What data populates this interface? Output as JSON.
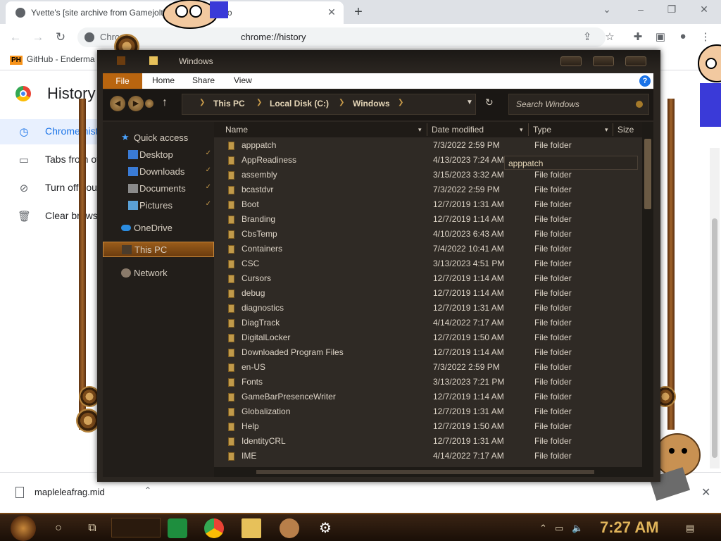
{
  "browser": {
    "tab_title": "Yvette's [site archive from Gamejolt] by Yvette - itch.io",
    "tab_close": "✕",
    "new_tab": "+",
    "window_controls": [
      "⌄",
      "–",
      "❐",
      "✕"
    ],
    "back": "←",
    "forward": "→",
    "reload": "↻",
    "url_chip": "Chrome",
    "url_path": "chrome://history",
    "toolbar_icons": [
      "share-icon",
      "star-icon",
      "extensions-icon",
      "sidepanel-icon",
      "profile-icon",
      "menu-icon"
    ],
    "bookmark": {
      "badge": "PH",
      "label": "GitHub - Enderma"
    },
    "history": {
      "title": "History",
      "nav": [
        {
          "label": "Chrome history",
          "icon": "clock-icon",
          "active": true
        },
        {
          "label": "Tabs from other devices",
          "icon": "devices-icon",
          "active": false
        },
        {
          "label": "Turn off Journeys",
          "icon": "journeys-off-icon",
          "active": false
        },
        {
          "label": "Clear browsing data",
          "icon": "trash-icon",
          "active": false
        }
      ]
    },
    "download": {
      "filename": "mapleleafrag.mid",
      "caret": "⌃",
      "close": "✕"
    }
  },
  "explorer": {
    "title": "Windows",
    "ribbon_tabs": [
      "File",
      "Home",
      "Share",
      "View"
    ],
    "help": "?",
    "breadcrumbs": [
      "This PC",
      "Local Disk (C:)",
      "Windows"
    ],
    "search_placeholder": "Search Windows",
    "nav_pane": [
      {
        "label": "Quick access",
        "icon": "star-icon",
        "indent": false,
        "pinned": false,
        "selected": false
      },
      {
        "label": "Desktop",
        "icon": "desktop-folder-icon",
        "indent": true,
        "pinned": true,
        "selected": false
      },
      {
        "label": "Downloads",
        "icon": "downloads-folder-icon",
        "indent": true,
        "pinned": true,
        "selected": false
      },
      {
        "label": "Documents",
        "icon": "documents-folder-icon",
        "indent": true,
        "pinned": true,
        "selected": false
      },
      {
        "label": "Pictures",
        "icon": "pictures-folder-icon",
        "indent": true,
        "pinned": true,
        "selected": false
      },
      {
        "label": "OneDrive",
        "icon": "cloud-icon",
        "indent": false,
        "pinned": false,
        "selected": false
      },
      {
        "label": "This PC",
        "icon": "computer-icon",
        "indent": false,
        "pinned": false,
        "selected": true
      },
      {
        "label": "Network",
        "icon": "network-icon",
        "indent": false,
        "pinned": false,
        "selected": false
      }
    ],
    "columns": [
      "Name",
      "Date modified",
      "Type",
      "Size"
    ],
    "files": [
      {
        "name": "apppatch",
        "date": "7/3/2022 2:59 PM",
        "type": "File folder"
      },
      {
        "name": "AppReadiness",
        "date": "4/13/2023 7:24 AM",
        "type": "File folder"
      },
      {
        "name": "assembly",
        "date": "3/15/2023 3:32 AM",
        "type": "File folder"
      },
      {
        "name": "bcastdvr",
        "date": "7/3/2022 2:59 PM",
        "type": "File folder"
      },
      {
        "name": "Boot",
        "date": "12/7/2019 1:31 AM",
        "type": "File folder"
      },
      {
        "name": "Branding",
        "date": "12/7/2019 1:14 AM",
        "type": "File folder"
      },
      {
        "name": "CbsTemp",
        "date": "4/10/2023 6:43 AM",
        "type": "File folder"
      },
      {
        "name": "Containers",
        "date": "7/4/2022 10:41 AM",
        "type": "File folder"
      },
      {
        "name": "CSC",
        "date": "3/13/2023 4:51 PM",
        "type": "File folder"
      },
      {
        "name": "Cursors",
        "date": "12/7/2019 1:14 AM",
        "type": "File folder"
      },
      {
        "name": "debug",
        "date": "12/7/2019 1:14 AM",
        "type": "File folder"
      },
      {
        "name": "diagnostics",
        "date": "12/7/2019 1:31 AM",
        "type": "File folder"
      },
      {
        "name": "DiagTrack",
        "date": "4/14/2022 7:17 AM",
        "type": "File folder"
      },
      {
        "name": "DigitalLocker",
        "date": "12/7/2019 1:50 AM",
        "type": "File folder"
      },
      {
        "name": "Downloaded Program Files",
        "date": "12/7/2019 1:14 AM",
        "type": "File folder"
      },
      {
        "name": "en-US",
        "date": "7/3/2022 2:59 PM",
        "type": "File folder"
      },
      {
        "name": "Fonts",
        "date": "3/13/2023 7:21 PM",
        "type": "File folder"
      },
      {
        "name": "GameBarPresenceWriter",
        "date": "12/7/2019 1:14 AM",
        "type": "File folder"
      },
      {
        "name": "Globalization",
        "date": "12/7/2019 1:31 AM",
        "type": "File folder"
      },
      {
        "name": "Help",
        "date": "12/7/2019 1:50 AM",
        "type": "File folder"
      },
      {
        "name": "IdentityCRL",
        "date": "12/7/2019 1:31 AM",
        "type": "File folder"
      },
      {
        "name": "IME",
        "date": "4/14/2022 7:17 AM",
        "type": "File folder"
      }
    ],
    "tooltip": "apppatch"
  },
  "taskbar": {
    "clock": "7:27 AM",
    "buttons": [
      "cortana-icon",
      "task-view-icon"
    ],
    "apps": [
      "sheets-icon",
      "chrome-icon",
      "file-explorer-icon",
      "pet-app-icon",
      "settings-icon"
    ],
    "tray": [
      "chevron-icon",
      "network-icon",
      "volume-muted-icon",
      "notification-icon"
    ]
  },
  "colors": {
    "accent": "#b9650f",
    "explorer_bg": "#2b2621",
    "chrome_active": "#1a73e8",
    "clock": "#e0b45a"
  }
}
